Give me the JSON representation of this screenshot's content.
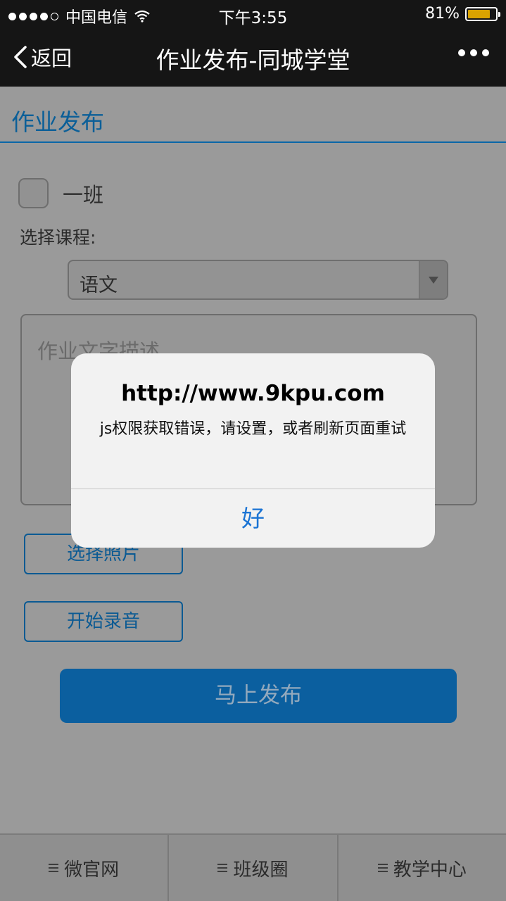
{
  "status_bar": {
    "carrier": "中国电信",
    "time": "下午3:55",
    "battery_percent": "81%",
    "battery_level": 0.81,
    "battery_color": "#d9a300"
  },
  "nav": {
    "back_label": "返回",
    "title": "作业发布-同城学堂",
    "back_icon": "chevron-left-icon",
    "more_icon": "more-dots-icon"
  },
  "page": {
    "header_title": "作业发布",
    "class_label": "一班",
    "class_checked": false,
    "course_label": "选择课程:",
    "course_selected": "语文",
    "description_placeholder": "作业文字描述",
    "select_photo_label": "选择照片",
    "record_label": "开始录音",
    "publish_label": "马上发布",
    "accent_color": "#0b5f9f"
  },
  "tabs": [
    {
      "label": "微官网",
      "icon": "menu-icon"
    },
    {
      "label": "班级圈",
      "icon": "menu-icon"
    },
    {
      "label": "教学中心",
      "icon": "menu-icon"
    }
  ],
  "alert": {
    "title": "http://www.9kpu.com",
    "message": "js权限获取错误，请设置，或者刷新页面重试",
    "button_label": "好",
    "button_color": "#1b74d4"
  }
}
